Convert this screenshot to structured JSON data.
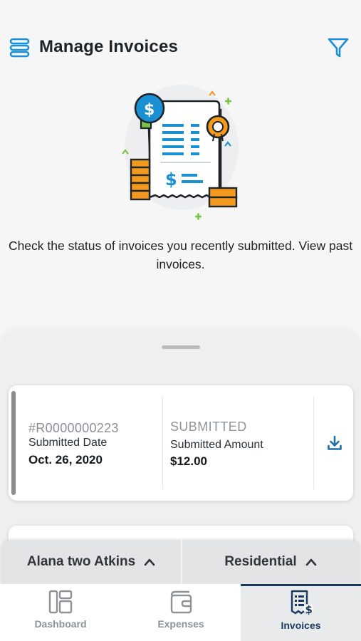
{
  "header": {
    "title": "Manage Invoices",
    "menu_icon": "stack-menu-icon",
    "filter_icon": "filter-icon"
  },
  "hero": {
    "illustration": "invoice-receipt-illustration",
    "description": "Check the status of invoices you recently submitted. View past invoices."
  },
  "invoices": [
    {
      "number": "#R0000000223",
      "date_label": "Submitted Date",
      "date": "Oct. 26, 2020",
      "status": "SUBMITTED",
      "amount_label": "Submitted Amount",
      "amount": "$12.00",
      "action_icon": "download-icon"
    }
  ],
  "selectors": {
    "person": "Alana two Atkins",
    "type": "Residential"
  },
  "tabs": [
    {
      "label": "Dashboard",
      "icon": "dashboard-icon",
      "active": false
    },
    {
      "label": "Expenses",
      "icon": "wallet-icon",
      "active": false
    },
    {
      "label": "Invoices",
      "icon": "invoice-dollar-icon",
      "active": true
    }
  ],
  "colors": {
    "accent_blue": "#1a8fd1",
    "navy": "#1b3a5c",
    "orange": "#f39a1e",
    "green": "#7cc242",
    "status_grey": "#8f959a"
  }
}
